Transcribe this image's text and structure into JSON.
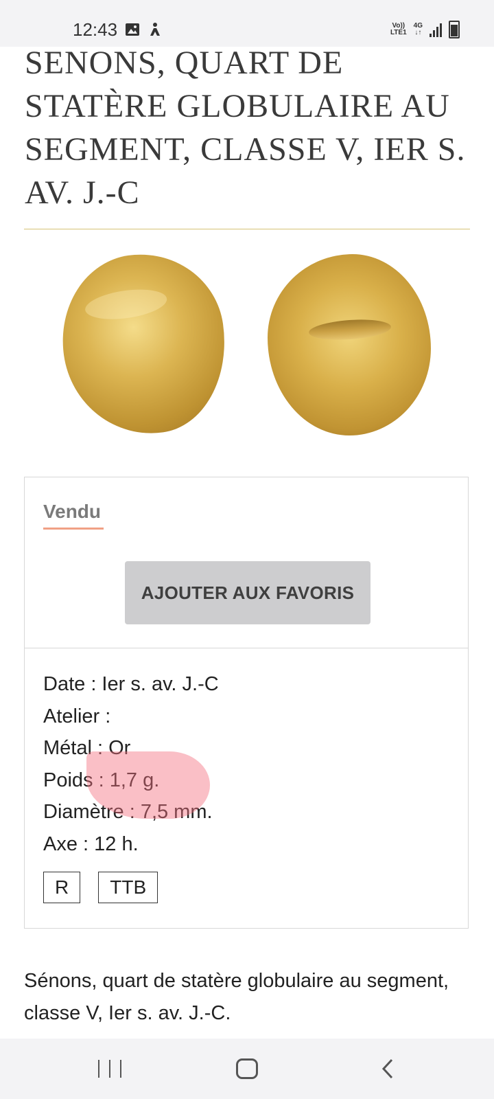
{
  "status_bar": {
    "time": "12:43",
    "network_top": "Vo))",
    "network_bottom": "LTE1",
    "data_top": "4G",
    "data_bottom": "↓↑"
  },
  "product": {
    "title": "SENONS, QUART DE STATÈRE GLOBULAIRE AU SEGMENT, CLASSE V, IER S. AV. J.-C",
    "status_label": "Vendu",
    "favorite_button": "AJOUTER AUX FAVORIS",
    "specs": [
      "Date : Ier s. av. J.-C",
      "Atelier :",
      "Métal : Or",
      "Poids : 1,7 g.",
      "Diamètre : 7,5 mm.",
      "Axe : 12 h."
    ],
    "grades": [
      "R",
      "TTB"
    ],
    "description": "Sénons, quart de statère globulaire au segment, classe V, Ier s. av. J.-C."
  },
  "colors": {
    "title_divider": "#d6c274",
    "sold_underline": "#f0a085",
    "button_bg": "#cdcdcf",
    "highlight": "#f37080"
  },
  "nav_bar": {
    "icons": [
      "recents-icon",
      "home-icon",
      "back-icon"
    ]
  }
}
